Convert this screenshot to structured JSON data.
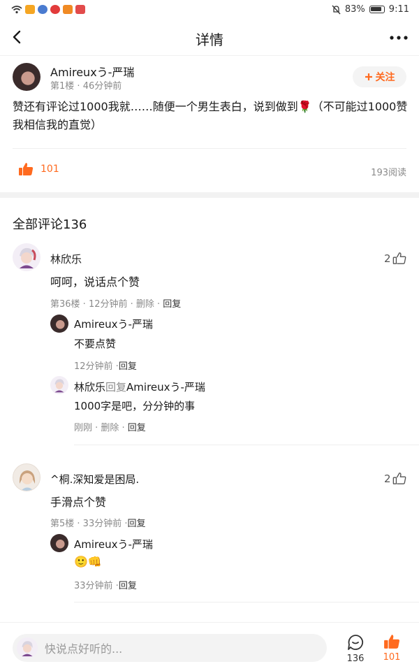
{
  "status_bar": {
    "battery": "83%",
    "time": "9:11"
  },
  "header": {
    "title": "详情"
  },
  "post": {
    "author": "Amireuxう-严瑞",
    "floor": "第1楼",
    "time": "46分钟前",
    "follow_label": "关注",
    "text": "赞还有评论过1000我就……随便一个男生表白，说到做到🌹（不可能过1000赞我相信我的直觉）",
    "likes": "101",
    "reads": "193阅读"
  },
  "comments_header": "全部评论136",
  "comments": [
    {
      "name": "林欣乐",
      "text": "呵呵，说话点个赞",
      "meta_prefix": "第36楼 · 12分钟前 · 删除 · ",
      "reply_label": "回复",
      "likes": "2",
      "replies": [
        {
          "name": "Amireuxう-严瑞",
          "text": "不要点赞",
          "meta_prefix": "12分钟前 ·",
          "reply_label": "回复"
        },
        {
          "name": "林欣乐",
          "reply_word": "回复",
          "reply_target": "Amireuxう-严瑞",
          "text": "1000字是吧，分分钟的事",
          "meta_prefix": "刚刚 · 删除 · ",
          "reply_label": "回复"
        }
      ]
    },
    {
      "name": "^桐.深知爱是困局.",
      "text": "手滑点个赞",
      "meta_prefix": "第5楼 · 33分钟前 ·",
      "reply_label": "回复",
      "likes": "2",
      "replies": [
        {
          "name": "Amireuxう-严瑞",
          "text": "🙂👊",
          "meta_prefix": "33分钟前 ·",
          "reply_label": "回复"
        }
      ]
    }
  ],
  "bottom_bar": {
    "input_placeholder": "快说点好听的...",
    "comment_count": "136",
    "like_count": "101"
  },
  "colors": {
    "accent": "#ff6a1f",
    "grey_text": "#8a8a8a"
  }
}
